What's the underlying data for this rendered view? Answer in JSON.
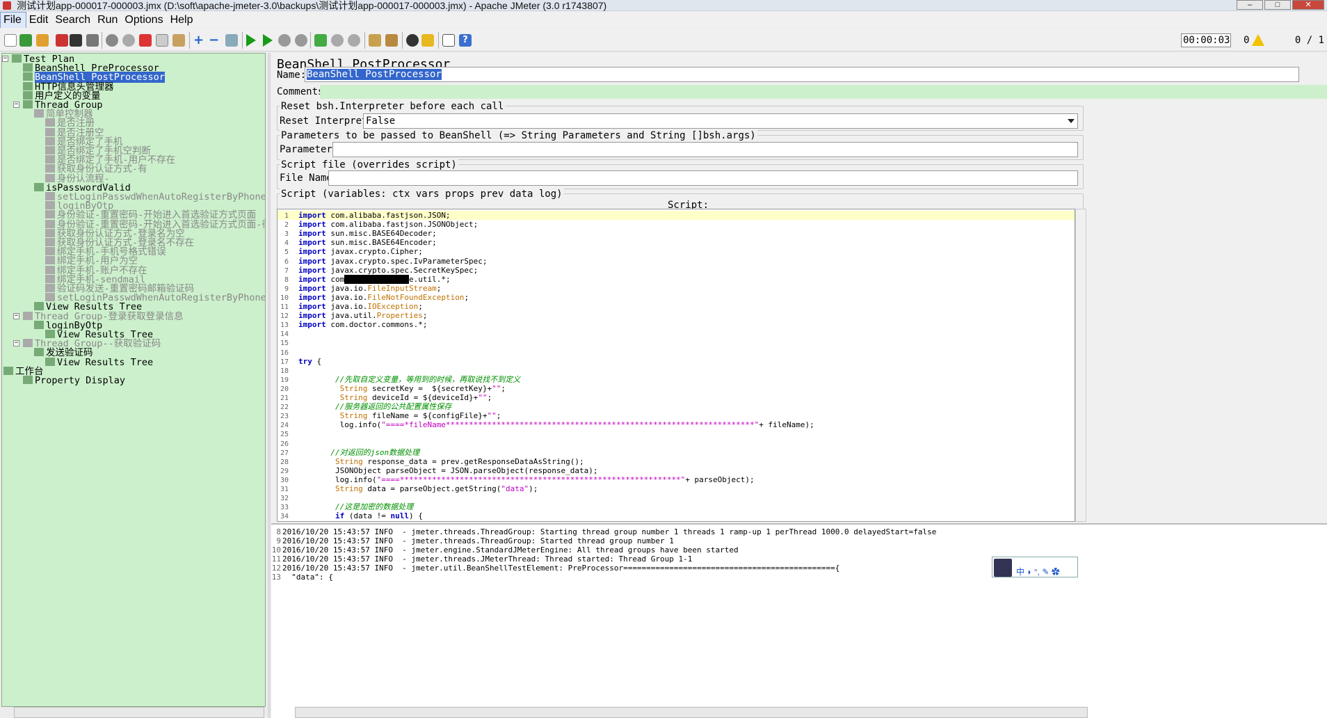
{
  "window": {
    "title": "测试计划app-000017-000003.jmx (D:\\soft\\apache-jmeter-3.0\\backups\\测试计划app-000017-000003.jmx) - Apache JMeter (3.0 r1743807)"
  },
  "menu": [
    "File",
    "Edit",
    "Search",
    "Run",
    "Options",
    "Help"
  ],
  "status": {
    "elapsed": "00:00:03",
    "errors": "0",
    "threads": "0 / 1"
  },
  "tree": [
    {
      "label": "Test Plan",
      "disabled": false
    },
    {
      "label": "BeanShell PreProcessor",
      "disabled": false
    },
    {
      "label": "BeanShell PostProcessor",
      "disabled": false,
      "selected": true
    },
    {
      "label": "HTTP信息头管理器",
      "disabled": false
    },
    {
      "label": "用户定义的变量",
      "disabled": false
    },
    {
      "label": "Thread Group",
      "disabled": false
    },
    {
      "label": "简单控制器",
      "disabled": true
    },
    {
      "label": "是否注册",
      "disabled": true
    },
    {
      "label": "是否注册空",
      "disabled": true
    },
    {
      "label": "是否绑定了手机",
      "disabled": true
    },
    {
      "label": "是否绑定了手机空判断",
      "disabled": true
    },
    {
      "label": "是否绑定了手机-用户不存在",
      "disabled": true
    },
    {
      "label": "获取身份认证方式-有",
      "disabled": true
    },
    {
      "label": "身份认流程-",
      "disabled": true
    },
    {
      "label": "isPasswordValid",
      "disabled": false
    },
    {
      "label": "setLoginPasswdWhenAutoRegisterByPhone",
      "disabled": true
    },
    {
      "label": "loginByOtp",
      "disabled": true
    },
    {
      "label": "身份验证-重置密码-开始进入首选验证方式页面",
      "disabled": true
    },
    {
      "label": "身份验证-重置密码-开始进入首选验证方式页面-得到首选",
      "disabled": true
    },
    {
      "label": "获取身份认证方式-登录名为空",
      "disabled": true
    },
    {
      "label": "获取身份认证方式-登录名不存在",
      "disabled": true
    },
    {
      "label": "绑定手机-手机号格式错误",
      "disabled": true
    },
    {
      "label": "绑定手机-用户为空",
      "disabled": true
    },
    {
      "label": "绑定手机-账户不存在",
      "disabled": true
    },
    {
      "label": "绑定手机-sendmail",
      "disabled": true
    },
    {
      "label": "验证码发送-重置密码邮箱验证码",
      "disabled": true
    },
    {
      "label": "setLoginPasswdWhenAutoRegisterByPhone",
      "disabled": true
    },
    {
      "label": "View Results Tree",
      "disabled": false
    },
    {
      "label": "Thread Group-登录获取登录信息",
      "disabled": true
    },
    {
      "label": "loginByOtp",
      "disabled": false
    },
    {
      "label": "View Results Tree",
      "disabled": false
    },
    {
      "label": "Thread Group--获取验证码",
      "disabled": true
    },
    {
      "label": "发送验证码",
      "disabled": false
    },
    {
      "label": "View Results Tree",
      "disabled": false
    },
    {
      "label": "工作台",
      "disabled": false
    },
    {
      "label": "Property Display",
      "disabled": false
    }
  ],
  "panel": {
    "title": "BeanShell PostProcessor",
    "name_label": "Name:",
    "name_value": "BeanShell PostProcessor",
    "comments_label": "Comments:",
    "reset_legend": "Reset bsh.Interpreter before each call",
    "reset_label": "Reset Interpreter:",
    "reset_value": "False",
    "params_legend": "Parameters to be passed to BeanShell (=> String Parameters and String []bsh.args)",
    "params_label": "Parameters:",
    "file_legend": "Script file (overrides script)",
    "file_label": "File Name:",
    "script_legend": "Script (variables: ctx vars props prev data log)",
    "script_label": "Script:"
  },
  "script_lines": [
    {
      "n": "1",
      "html": "<span class='kw'>import</span> com.alibaba.fastjson.JSON;",
      "hl": true
    },
    {
      "n": "2",
      "html": "<span class='kw'>import</span> com.alibaba.fastjson.JSONObject;"
    },
    {
      "n": "3",
      "html": "<span class='kw'>import</span> sun.misc.BASE64Decoder;"
    },
    {
      "n": "4",
      "html": "<span class='kw'>import</span> sun.misc.BASE64Encoder;"
    },
    {
      "n": "5",
      "html": "<span class='kw'>import</span> javax.crypto.Cipher;"
    },
    {
      "n": "6",
      "html": "<span class='kw'>import</span> javax.crypto.spec.IvParameterSpec;"
    },
    {
      "n": "7",
      "html": "<span class='kw'>import</span> javax.crypto.spec.SecretKeySpec;"
    },
    {
      "n": "8",
      "html": "<span class='kw'>import</span> com<span style='background:#000;color:#000'>.xxxxxxxxxxxxx</span>e.util.*;"
    },
    {
      "n": "9",
      "html": "<span class='kw'>import</span> java.io.<span class='ty'>FileInputStream</span>;"
    },
    {
      "n": "10",
      "html": "<span class='kw'>import</span> java.io.<span class='ty'>FileNotFoundException</span>;"
    },
    {
      "n": "11",
      "html": "<span class='kw'>import</span> java.io.<span class='ty'>IOException</span>;"
    },
    {
      "n": "12",
      "html": "<span class='kw'>import</span> java.util.<span class='ty'>Properties</span>;"
    },
    {
      "n": "13",
      "html": "<span class='kw'>import</span> com.doctor.commons.*;"
    },
    {
      "n": "14",
      "html": ""
    },
    {
      "n": "15",
      "html": ""
    },
    {
      "n": "16",
      "html": ""
    },
    {
      "n": "17",
      "html": "<span class='kw'>try</span> {"
    },
    {
      "n": "18",
      "html": ""
    },
    {
      "n": "19",
      "html": "        <span class='cm'>//先取自定义变量，等用到的时候，再取说找不到定义</span>"
    },
    {
      "n": "20",
      "html": "         <span class='ty'>String</span> secretKey =  ${secretKey}+<span class='st'>\"\"</span>;"
    },
    {
      "n": "21",
      "html": "         <span class='ty'>String</span> deviceId = ${deviceId}+<span class='st'>\"\"</span>;"
    },
    {
      "n": "22",
      "html": "        <span class='cm'>//服务器返回的公共配置属性保存</span>"
    },
    {
      "n": "23",
      "html": "         <span class='ty'>String</span> fileName = ${configFile}+<span class='st'>\"\"</span>;"
    },
    {
      "n": "24",
      "html": "         log.info(<span class='st'>\"====*fileName*******************************************************************\"</span>+ fileName);"
    },
    {
      "n": "25",
      "html": ""
    },
    {
      "n": "26",
      "html": ""
    },
    {
      "n": "27",
      "html": "       <span class='cm'>//对返回的json数据处理</span>"
    },
    {
      "n": "28",
      "html": "        <span class='ty'>String</span> response_data = prev.getResponseDataAsString();"
    },
    {
      "n": "29",
      "html": "        JSONObject parseObject = JSON.parseObject(response_data);"
    },
    {
      "n": "30",
      "html": "        log.info(<span class='st'>\"====*************************************************************\"</span>+ parseObject);"
    },
    {
      "n": "31",
      "html": "        <span class='ty'>String</span> data = parseObject.getString(<span class='st'>\"data\"</span>);"
    },
    {
      "n": "32",
      "html": ""
    },
    {
      "n": "33",
      "html": "        <span class='cm'>//这是加密的数据处理</span>"
    },
    {
      "n": "34",
      "html": "        <span class='kw'>if</span> (data != <span class='kw'>null</span>) {"
    }
  ],
  "log_lines": [
    {
      "n": "8",
      "text": "2016/10/20 15:43:57 INFO  - jmeter.threads.ThreadGroup: Starting thread group number 1 threads 1 ramp-up 1 perThread 1000.0 delayedStart=false"
    },
    {
      "n": "9",
      "text": "2016/10/20 15:43:57 INFO  - jmeter.threads.ThreadGroup: Started thread group number 1"
    },
    {
      "n": "10",
      "text": "2016/10/20 15:43:57 INFO  - jmeter.engine.StandardJMeterEngine: All thread groups have been started"
    },
    {
      "n": "11",
      "text": "2016/10/20 15:43:57 INFO  - jmeter.threads.JMeterThread: Thread started: Thread Group 1-1"
    },
    {
      "n": "12",
      "text": "2016/10/20 15:43:57 INFO  - jmeter.util.BeanShellTestElement: PreProcessor=============================================={"
    },
    {
      "n": "13",
      "text": "  \"data\": {"
    }
  ],
  "ime": {
    "text": "中 ◗ °, ✎ ✿"
  }
}
